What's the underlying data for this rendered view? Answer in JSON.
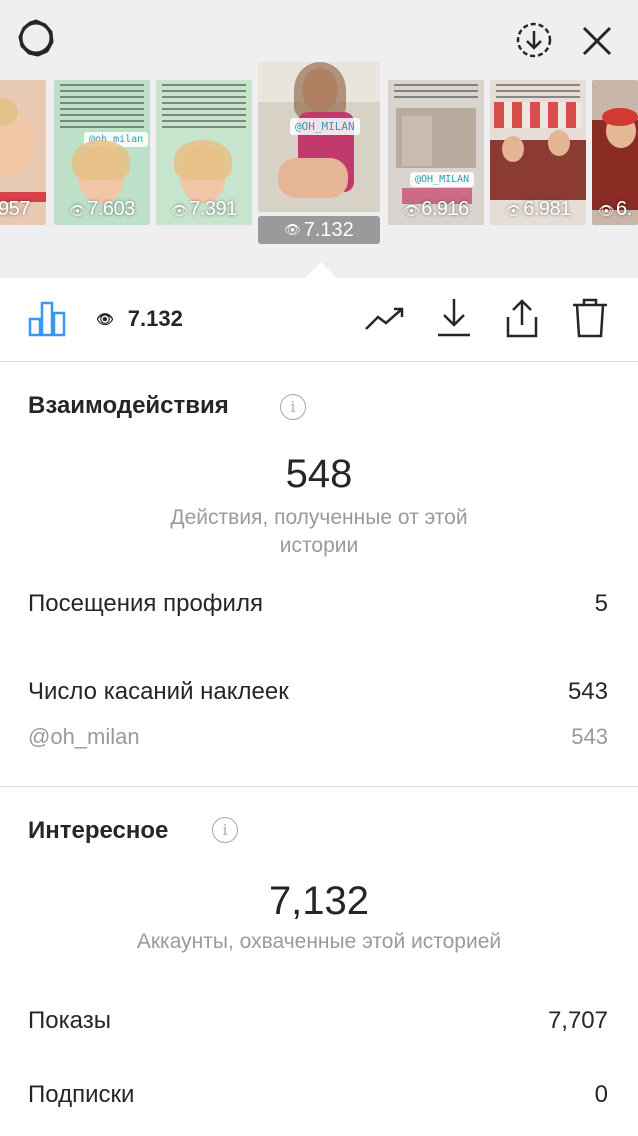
{
  "header": {
    "settings_icon": "gear-icon",
    "download_icon": "download-circle-icon",
    "close_icon": "close-icon"
  },
  "thumbnails": [
    {
      "count": "957",
      "bg": "#e8c9b3",
      "type": "face"
    },
    {
      "count": "7.603",
      "bg": "#bde0c9",
      "type": "face-text",
      "mention": "@oh_milan"
    },
    {
      "count": "7.391",
      "bg": "#c7e4cd",
      "type": "face-text"
    },
    {
      "count": "7.132",
      "bg": "#d8d2c6",
      "type": "active",
      "mention": "@OH_MILAN"
    },
    {
      "count": "6.916",
      "bg": "#d9d4cf",
      "type": "city",
      "mention": "@OH_MILAN"
    },
    {
      "count": "6.981",
      "bg": "#e6ded6",
      "type": "cafe"
    },
    {
      "count": "6.",
      "bg": "#c9b5a8",
      "type": "red"
    }
  ],
  "active_badge": "7.132",
  "toolbar": {
    "views": "7.132",
    "icons": [
      "bar-chart-icon",
      "trend-icon",
      "download-icon",
      "share-icon",
      "trash-icon"
    ]
  },
  "interactions": {
    "title": "Взаимодействия",
    "total": "548",
    "caption": "Действия, полученные от этой истории",
    "rows": [
      {
        "label": "Посещения профиля",
        "value": "5"
      },
      {
        "label": "Число касаний наклеек",
        "value": "543"
      }
    ],
    "sub_row": {
      "label": "@oh_milan",
      "value": "543"
    }
  },
  "discovery": {
    "title": "Интересное",
    "total": "7,132",
    "caption": "Аккаунты, охваченные этой историей",
    "rows": [
      {
        "label": "Показы",
        "value": "7,707"
      },
      {
        "label": "Подписки",
        "value": "0"
      }
    ]
  },
  "colors": {
    "accent": "#3897f0",
    "text": "#262626",
    "muted": "#9a9a9a",
    "top_bg": "#efeff1"
  }
}
